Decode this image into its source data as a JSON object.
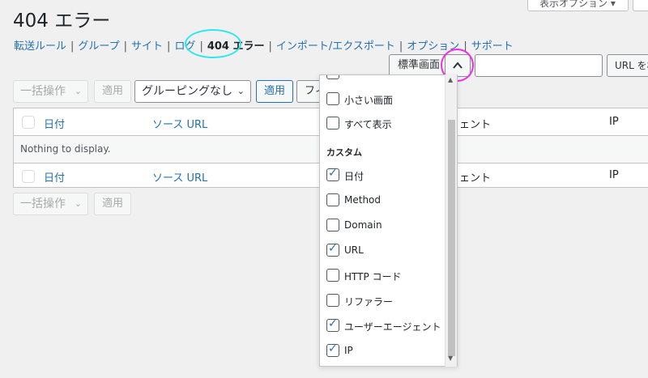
{
  "page": {
    "title": "404 エラー"
  },
  "top_right": {
    "screen_options": "表示オプション ▾"
  },
  "subsubsub": [
    {
      "label": "転送ルール"
    },
    {
      "label": "グループ"
    },
    {
      "label": "サイト"
    },
    {
      "label": "ログ"
    },
    {
      "label": "404 エラー",
      "current": true
    },
    {
      "label": "インポート/エクスポート"
    },
    {
      "label": "オプション"
    },
    {
      "label": "サポート"
    }
  ],
  "toolbar": {
    "display_mode": "標準画面",
    "search_button": "URL を検",
    "bulk_select": "一括操作",
    "apply": "適用",
    "grouping_select": "グルーピングなし",
    "apply2": "適用",
    "filter_partial": "フィ"
  },
  "table": {
    "columns": [
      "日付",
      "ソース URL",
      "ェント",
      "IP"
    ],
    "empty_message": "Nothing to display."
  },
  "bottom_toolbar": {
    "bulk_select": "一括操作",
    "apply": "適用"
  },
  "dropdown": {
    "top_partial_label": "",
    "options": [
      {
        "label": "小さい画面",
        "checked": false
      },
      {
        "label": "すべて表示",
        "checked": false
      }
    ],
    "heading": "カスタム",
    "custom": [
      {
        "label": "日付",
        "checked": true
      },
      {
        "label": "Method",
        "checked": false
      },
      {
        "label": "Domain",
        "checked": false
      },
      {
        "label": "URL",
        "checked": true
      },
      {
        "label": "HTTP コード",
        "checked": false
      },
      {
        "label": "リファラー",
        "checked": false
      },
      {
        "label": "ユーザーエージェント",
        "checked": true
      },
      {
        "label": "IP",
        "checked": true
      }
    ]
  },
  "colors": {
    "link": "#2271b1",
    "highlight_cyan": "#2ee6f0",
    "highlight_magenta": "#f02ee0"
  }
}
